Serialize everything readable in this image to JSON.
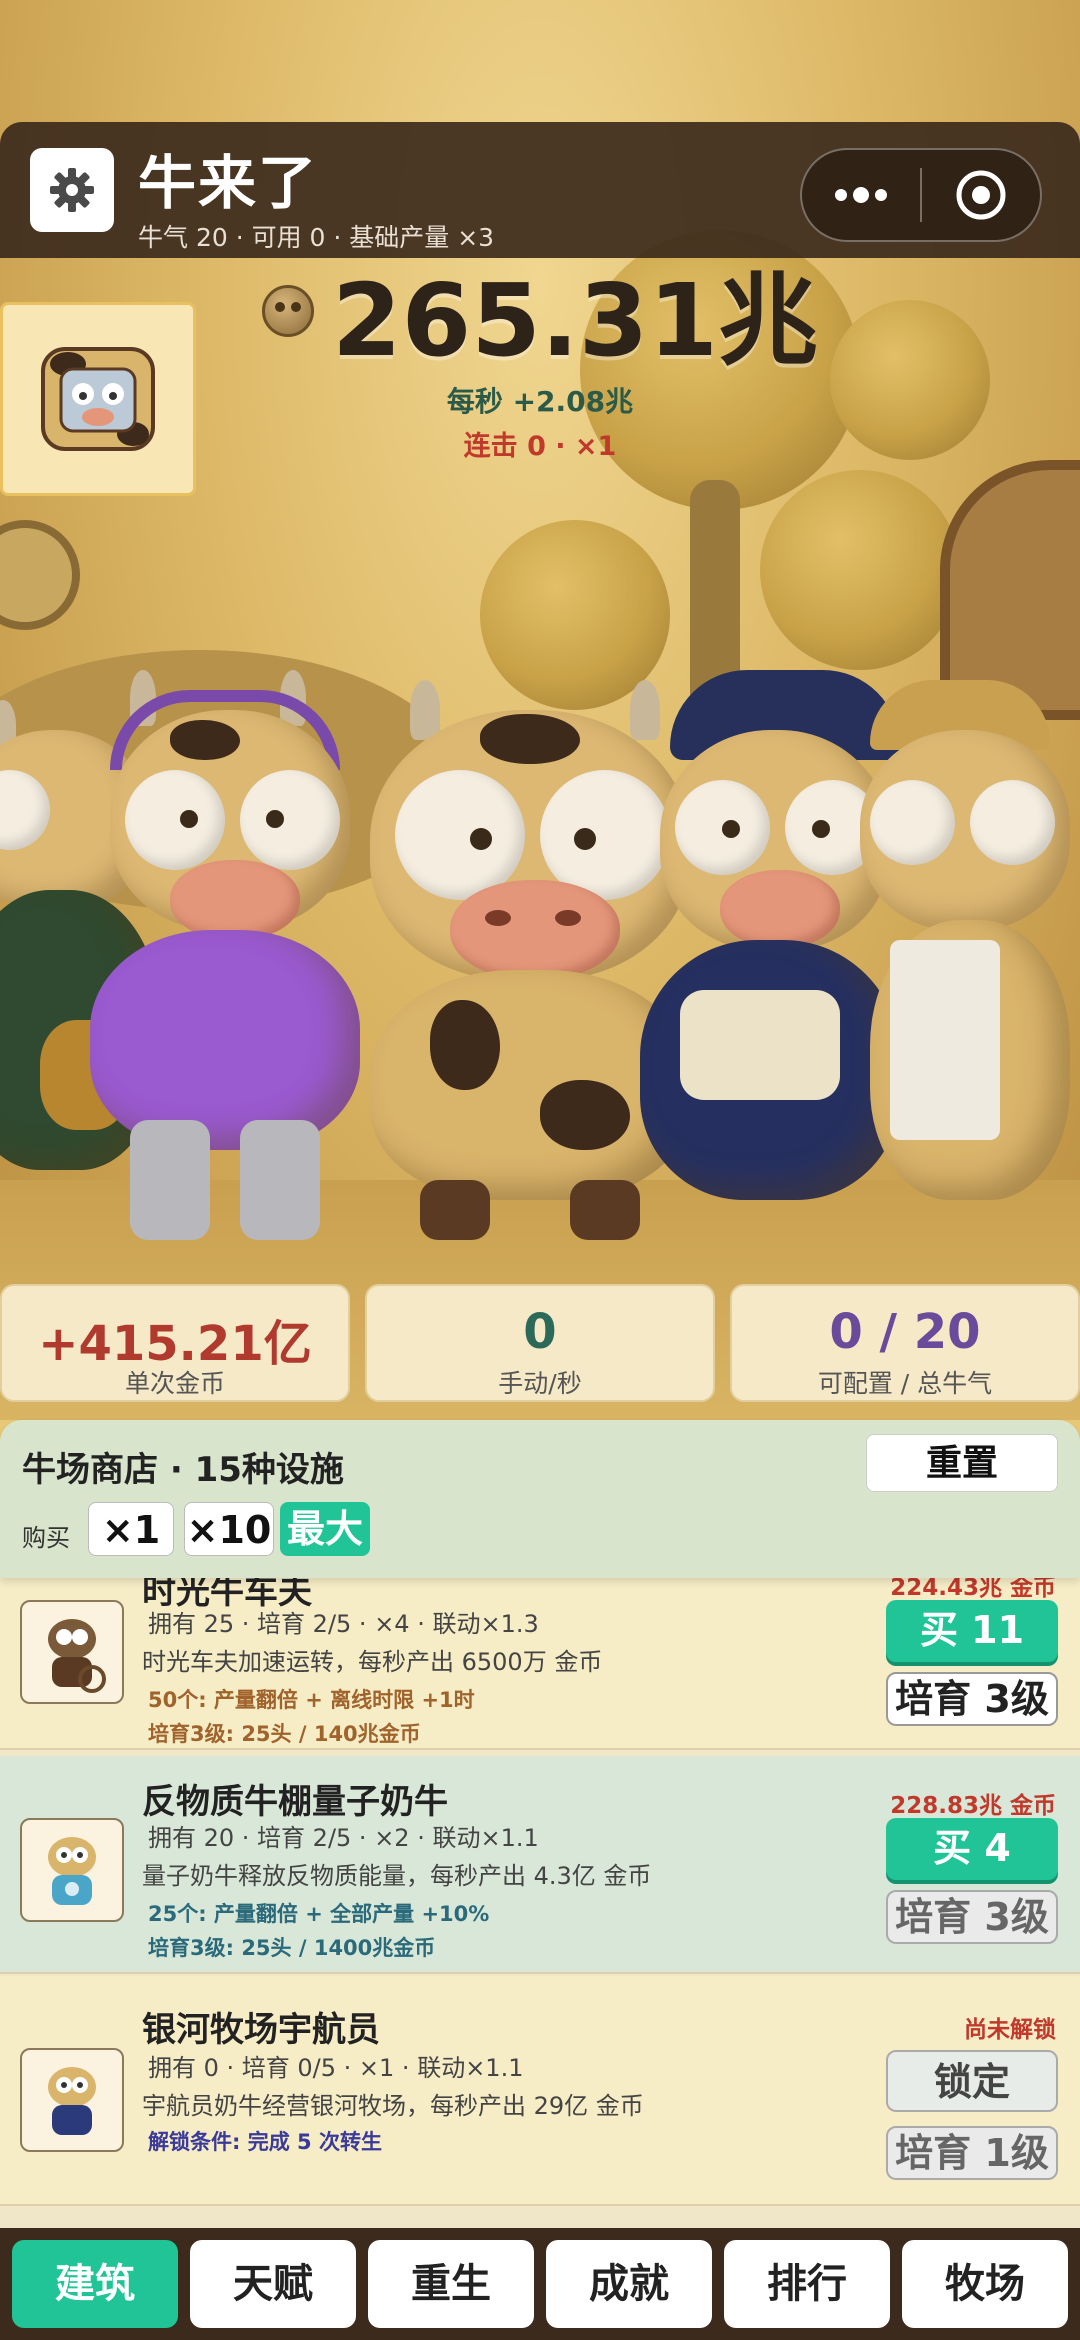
{
  "header": {
    "title": "牛来了",
    "subtitle": "牛气 20 · 可用 0 · 基础产量 ×3",
    "settings_icon": "gear-icon",
    "more_icon": "more-dots-icon",
    "close_icon": "target-circle-icon"
  },
  "counter": {
    "total": "265.31兆",
    "per_second": "每秒 +2.08兆",
    "combo": "连击 0 · ×1"
  },
  "stats": [
    {
      "value": "+415.21亿",
      "label": "单次金币",
      "color": "#b03a2e"
    },
    {
      "value": "0",
      "label": "手动/秒",
      "color": "#2b6a58"
    },
    {
      "value": "0 / 20",
      "label": "可配置 / 总牛气",
      "color": "#6a4a9a"
    }
  ],
  "shop": {
    "title": "牛场商店 · 15种设施",
    "reset_label": "重置",
    "buy_label": "购买",
    "qty_options": [
      "×1",
      "×10",
      "最大"
    ],
    "qty_selected": "最大",
    "items": [
      {
        "name": "时光牛车夫",
        "price": "224.43兆 金币",
        "stats": "拥有 25 · 培育 2/5 · ×4 · 联动×1.3",
        "desc": "时光车夫加速运转，每秒产出 6500万 金币",
        "milestone": "50个: 产量翻倍 + 离线时限 +1时",
        "breed_info": "培育3级: 25头 / 140兆金币",
        "buy_label": "买 11",
        "breed_label": "培育 3级"
      },
      {
        "name": "反物质牛棚量子奶牛",
        "price": "228.83兆 金币",
        "stats": "拥有 20 · 培育 2/5 · ×2 · 联动×1.1",
        "desc": "量子奶牛释放反物质能量，每秒产出 4.3亿 金币",
        "milestone": "25个: 产量翻倍 + 全部产量 +10%",
        "breed_info": "培育3级: 25头 / 1400兆金币",
        "buy_label": "买 4",
        "breed_label": "培育 3级"
      },
      {
        "name": "银河牧场宇航员",
        "price": "尚未解锁",
        "stats": "拥有 0 · 培育 0/5 · ×1 · 联动×1.1",
        "desc": "宇航员奶牛经营银河牧场，每秒产出 29亿 金币",
        "unlock": "解锁条件: 完成 5 次转生",
        "lock_label": "锁定",
        "breed_label": "培育 1级"
      }
    ]
  },
  "tabs": [
    "建筑",
    "天赋",
    "重生",
    "成就",
    "排行",
    "牧场"
  ],
  "active_tab": "建筑",
  "colors": {
    "accent": "#21c497",
    "header_bg": "#3c2a1c",
    "price_red": "#c0392b"
  }
}
